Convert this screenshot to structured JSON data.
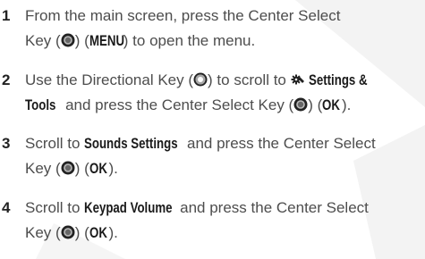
{
  "steps": [
    {
      "number": "1",
      "line1_a": "From the main screen, press the Center Select",
      "line2_a": "Key (",
      "line2_b": ") (",
      "line2_kw": "MENU",
      "line2_c": ") to open the menu."
    },
    {
      "number": "2",
      "line1_a": "Use the Directional Key (",
      "line1_b": ") to scroll to ",
      "line1_kw": "Settings &",
      "line2_kw": "Tools",
      "line2_a": " and press the Center Select Key (",
      "line2_b": ") (",
      "line2_kw2": "OK",
      "line2_c": ")."
    },
    {
      "number": "3",
      "line1_a": "Scroll to ",
      "line1_kw": "Sounds Settings",
      "line1_b": " and press the Center Select",
      "line2_a": "Key (",
      "line2_b": ") (",
      "line2_kw": "OK",
      "line2_c": ")."
    },
    {
      "number": "4",
      "line1_a": "Scroll to ",
      "line1_kw": "Keypad Volume",
      "line1_b": " and press the Center Select",
      "line2_a": "Key (",
      "line2_b": ") (",
      "line2_kw": "OK",
      "line2_c": ")."
    }
  ],
  "icons": {
    "center_select": "center-select-key-icon",
    "directional": "directional-key-icon",
    "settings": "settings-gear-icon"
  },
  "colors": {
    "text": "#4d4d4d",
    "number": "#222222",
    "keyword": "#1a1a1a",
    "watermark": "#f2f2f2"
  }
}
